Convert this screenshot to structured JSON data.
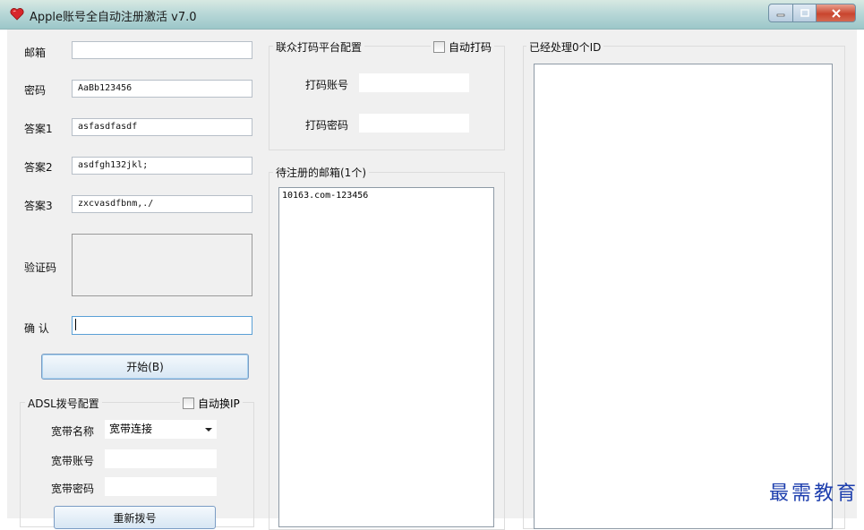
{
  "window": {
    "title": "Apple账号全自动注册激活 v7.0"
  },
  "account": {
    "email_label": "邮箱",
    "email_value": "",
    "password_label": "密码",
    "password_value": "AaBb123456",
    "answer1_label": "答案1",
    "answer1_value": "asfasdfasdf",
    "answer2_label": "答案2",
    "answer2_value": "asdfgh132jkl;",
    "answer3_label": "答案3",
    "answer3_value": "zxcvasdfbnm,./",
    "captcha_label": "验证码",
    "confirm_label": "确 认",
    "confirm_value": "",
    "start_button": "开始(B)"
  },
  "adsl": {
    "group_title": "ADSL拨号配置",
    "auto_switch_ip": "自动换IP",
    "auto_switch_ip_checked": false,
    "name_label": "宽带名称",
    "name_value": "宽带连接",
    "account_label": "宽带账号",
    "account_value": "",
    "password_label": "宽带密码",
    "password_value": "",
    "redial_button": "重新拨号"
  },
  "captcha_platform": {
    "group_title": "联众打码平台配置",
    "auto_code": "自动打码",
    "auto_code_checked": false,
    "account_label": "打码账号",
    "account_value": "",
    "password_label": "打码密码",
    "password_value": ""
  },
  "pending": {
    "group_title": "待注册的邮箱(1个)",
    "items": [
      "10163.com-123456"
    ]
  },
  "processed": {
    "group_title": "已经处理0个ID"
  },
  "watermark": "最需教育",
  "colors": {
    "accent": "#5aa0d6",
    "watermark": "#1e3fae",
    "close": "#c9452e"
  }
}
